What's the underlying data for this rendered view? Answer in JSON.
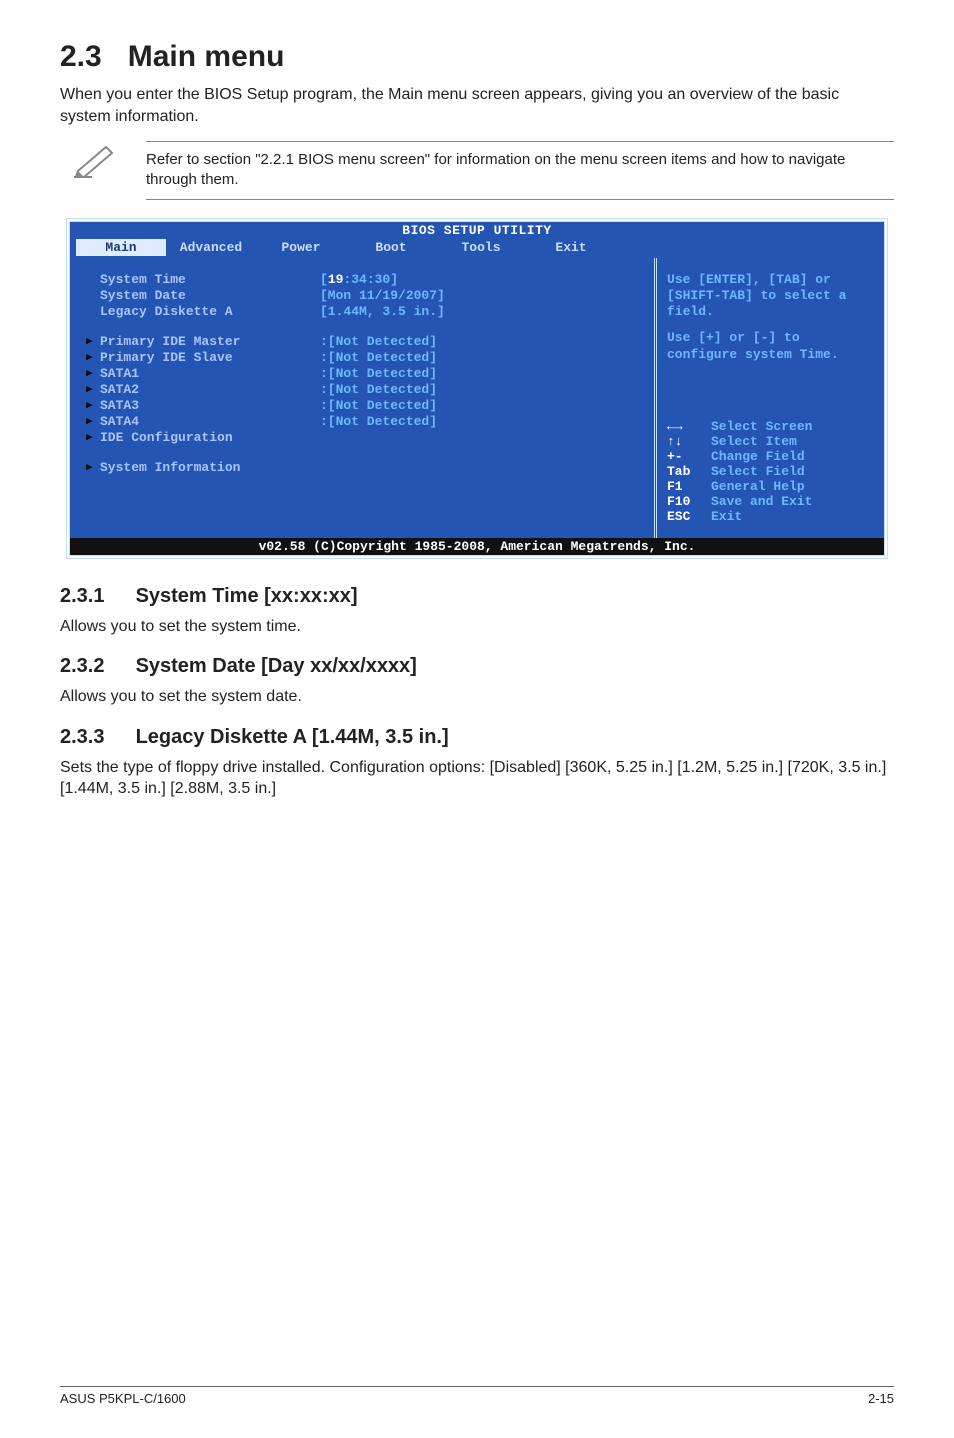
{
  "header": {
    "section_number": "2.3",
    "section_title": "Main menu"
  },
  "intro": "When you enter the BIOS Setup program, the Main menu screen appears, giving you an overview of the basic system information.",
  "note": "Refer to section \"2.2.1  BIOS menu screen\" for information on the menu screen items and how to navigate through them.",
  "bios": {
    "title": "BIOS SETUP UTILITY",
    "tabs": [
      "Main",
      "Advanced",
      "Power",
      "Boot",
      "Tools",
      "Exit"
    ],
    "rows_top": [
      {
        "label": "System Time",
        "value_pre": "[",
        "hour": "19",
        "value_post": ":34:30]"
      },
      {
        "label": "System Date",
        "value": "[Mon 11/19/2007]"
      },
      {
        "label": "Legacy Diskette A",
        "value": "[1.44M, 3.5 in.]"
      }
    ],
    "rows_mid": [
      {
        "label": "Primary IDE Master",
        "value": ":[Not Detected]"
      },
      {
        "label": "Primary IDE Slave",
        "value": ":[Not Detected]"
      },
      {
        "label": "SATA1",
        "value": ":[Not Detected]"
      },
      {
        "label": "SATA2",
        "value": ":[Not Detected]"
      },
      {
        "label": "SATA3",
        "value": ":[Not Detected]"
      },
      {
        "label": "SATA4",
        "value": ":[Not Detected]"
      },
      {
        "label": "IDE Configuration",
        "value": ""
      }
    ],
    "rows_bot": [
      {
        "label": "System Information",
        "value": ""
      }
    ],
    "help_top": "Use [ENTER], [TAB] or [SHIFT-TAB] to select a field.",
    "help_mid": "Use [+] or [-] to configure system Time.",
    "keys": [
      {
        "k": "←→",
        "v": "Select Screen"
      },
      {
        "k": "↑↓",
        "v": "Select Item"
      },
      {
        "k": "+-",
        "v": "Change Field"
      },
      {
        "k": "Tab",
        "v": "Select Field"
      },
      {
        "k": "F1",
        "v": "General Help"
      },
      {
        "k": "F10",
        "v": "Save and Exit"
      },
      {
        "k": "ESC",
        "v": "Exit"
      }
    ],
    "footer": "v02.58 (C)Copyright 1985-2008, American Megatrends, Inc."
  },
  "sections": [
    {
      "num": "2.3.1",
      "title": "System Time [xx:xx:xx]",
      "body": "Allows you to set the system time."
    },
    {
      "num": "2.3.2",
      "title": "System Date [Day xx/xx/xxxx]",
      "body": "Allows you to set the system date."
    },
    {
      "num": "2.3.3",
      "title": "Legacy Diskette A [1.44M, 3.5 in.]",
      "body": "Sets the type of floppy drive installed. Configuration options: [Disabled] [360K, 5.25 in.] [1.2M, 5.25 in.] [720K, 3.5 in.] [1.44M, 3.5 in.] [2.88M, 3.5 in.]"
    }
  ],
  "footer": {
    "left": "ASUS P5KPL-C/1600",
    "right": "2-15"
  }
}
